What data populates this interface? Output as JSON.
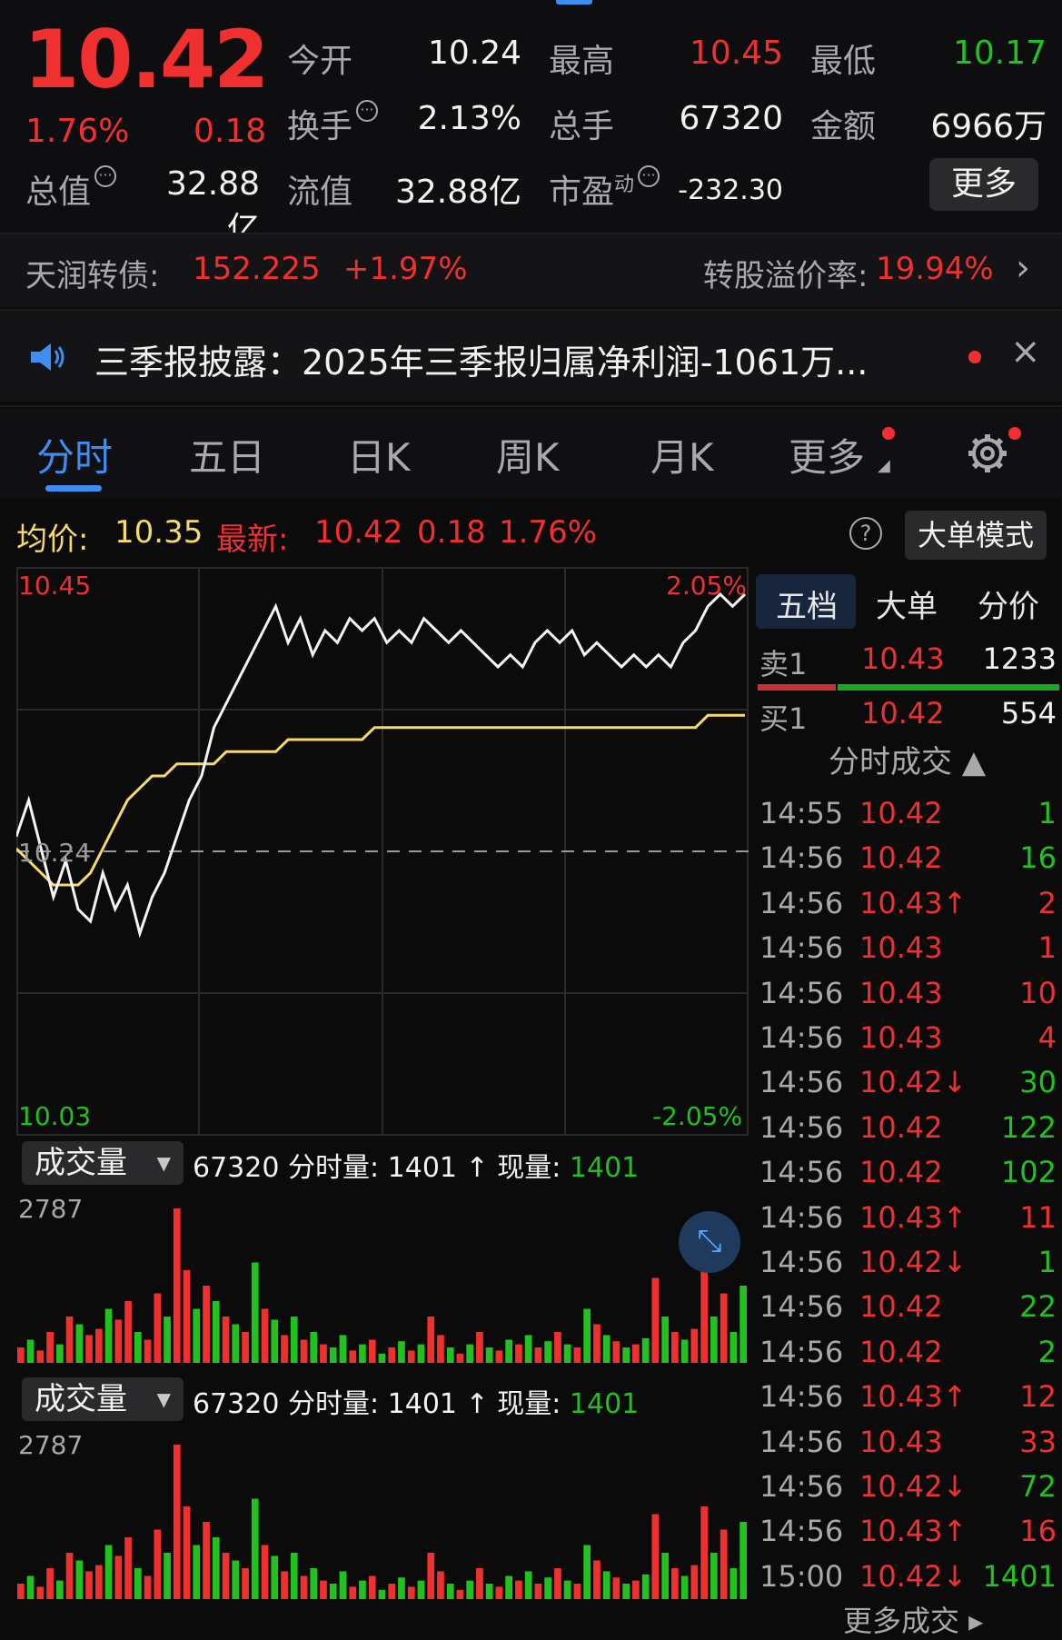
{
  "quote": {
    "price": "10.42",
    "change_pct": "1.76%",
    "change_abs": "0.18",
    "open_label": "今开",
    "open_value": "10.24",
    "high_label": "最高",
    "high_value": "10.45",
    "low_label": "最低",
    "low_value": "10.17",
    "turnover_label": "换手",
    "turnover_value": "2.13%",
    "volume_label": "总手",
    "volume_value": "67320",
    "amount_label": "金额",
    "amount_value": "6966万",
    "mktcap_label": "总值",
    "mktcap_value": "32.88亿",
    "float_label": "流值",
    "float_value": "32.88亿",
    "pe_label": "市盈",
    "pe_sup": "动",
    "pe_value": "-232.30",
    "more_label": "更多",
    "info_icon": "ellipsis-circle-icon"
  },
  "bond": {
    "name": "天润转债:",
    "price": "152.225",
    "change": "+1.97%",
    "premium_label": "转股溢价率:",
    "premium_value": "19.94%"
  },
  "news": {
    "text": "三季报披露：2025年三季报归属净利润-1061万...",
    "icon": "speaker-icon"
  },
  "tabs": {
    "items": [
      "分时",
      "五日",
      "日K",
      "周K",
      "月K",
      "更多"
    ],
    "active": "分时"
  },
  "avg_bar": {
    "avg_label": "均价:",
    "avg_value": "10.35",
    "latest_label": "最新:",
    "latest_price": "10.42",
    "latest_change": "0.18",
    "latest_pct": "1.76%",
    "big_order_mode": "大单模式"
  },
  "chart_data": {
    "type": "line",
    "price_high": "10.45",
    "price_low": "10.03",
    "pct_high": "2.05%",
    "pct_low": "-2.05%",
    "prev_close": "10.24",
    "ylim": [
      10.03,
      10.45
    ],
    "series": [
      {
        "values": [
          10.25,
          10.28,
          10.24,
          10.2,
          10.23,
          10.19,
          10.18,
          10.22,
          10.19,
          10.21,
          10.17,
          10.2,
          10.22,
          10.25,
          10.28,
          10.3,
          10.34,
          10.36,
          10.38,
          10.4,
          10.42,
          10.44,
          10.41,
          10.43,
          10.4,
          10.42,
          10.41,
          10.43,
          10.42,
          10.43,
          10.41,
          10.42,
          10.41,
          10.43,
          10.42,
          10.41,
          10.42,
          10.41,
          10.4,
          10.39,
          10.4,
          10.39,
          10.41,
          10.42,
          10.41,
          10.42,
          10.4,
          10.41,
          10.4,
          10.39,
          10.4,
          10.39,
          10.4,
          10.39,
          10.41,
          10.42,
          10.44,
          10.45,
          10.44,
          10.45
        ]
      },
      {
        "values": [
          10.24,
          10.23,
          10.22,
          10.21,
          10.21,
          10.21,
          10.22,
          10.24,
          10.26,
          10.28,
          10.29,
          10.3,
          10.3,
          10.31,
          10.31,
          10.31,
          10.31,
          10.32,
          10.32,
          10.32,
          10.32,
          10.32,
          10.33,
          10.33,
          10.33,
          10.33,
          10.33,
          10.33,
          10.33,
          10.34,
          10.34,
          10.34,
          10.34,
          10.34,
          10.34,
          10.34,
          10.34,
          10.34,
          10.34,
          10.34,
          10.34,
          10.34,
          10.34,
          10.34,
          10.34,
          10.34,
          10.34,
          10.34,
          10.34,
          10.34,
          10.34,
          10.34,
          10.34,
          10.34,
          10.34,
          10.34,
          10.35,
          10.35,
          10.35,
          10.35
        ]
      }
    ]
  },
  "volume": {
    "selector": "成交量",
    "total": "67320",
    "minute_label": "分时量:",
    "minute_value": "1401",
    "arrow": "↑",
    "current_label": "现量:",
    "current_value": "1401",
    "max": "2787",
    "bars": [
      0.1,
      0.15,
      0.08,
      0.2,
      0.12,
      0.3,
      0.25,
      0.18,
      0.22,
      0.35,
      0.28,
      0.4,
      0.2,
      0.15,
      0.45,
      0.3,
      1.0,
      0.6,
      0.35,
      0.5,
      0.4,
      0.3,
      0.25,
      0.2,
      0.65,
      0.35,
      0.28,
      0.18,
      0.3,
      0.15,
      0.2,
      0.12,
      0.1,
      0.18,
      0.08,
      0.12,
      0.15,
      0.06,
      0.1,
      0.14,
      0.08,
      0.12,
      0.3,
      0.18,
      0.1,
      0.06,
      0.12,
      0.2,
      0.1,
      0.08,
      0.15,
      0.12,
      0.18,
      0.1,
      0.14,
      0.2,
      0.12,
      0.1,
      0.35,
      0.25,
      0.18,
      0.14,
      0.1,
      0.12,
      0.16,
      0.55,
      0.3,
      0.2,
      0.15,
      0.22,
      0.6,
      0.3,
      0.45,
      0.2,
      0.5
    ],
    "bar_colors": [
      "red",
      "green",
      "red",
      "red",
      "green",
      "red",
      "green",
      "red",
      "red",
      "green",
      "red",
      "red",
      "green",
      "red",
      "red",
      "green",
      "red",
      "red",
      "green",
      "red",
      "green",
      "red",
      "green",
      "red",
      "green",
      "red",
      "green",
      "red",
      "green",
      "red",
      "green",
      "red",
      "green",
      "green",
      "red",
      "green",
      "red",
      "green",
      "red",
      "green",
      "red",
      "green",
      "red",
      "red",
      "green",
      "red",
      "green",
      "red",
      "green",
      "red",
      "green",
      "red",
      "green",
      "red",
      "green",
      "red",
      "green",
      "red",
      "green",
      "red",
      "green",
      "red",
      "green",
      "red",
      "green",
      "red",
      "green",
      "red",
      "green",
      "red",
      "red",
      "green",
      "red",
      "green",
      "green"
    ]
  },
  "right_panel": {
    "tabs": [
      "五档",
      "大单",
      "分价"
    ],
    "sell1_label": "卖1",
    "sell1_price": "10.43",
    "sell1_vol": "1233",
    "buy1_label": "买1",
    "buy1_price": "10.42",
    "buy1_vol": "554",
    "ticks_title": "分时成交 ▲",
    "ticks": [
      {
        "t": "14:55",
        "p": "10.42",
        "v": "1",
        "pc": "red",
        "vc": "green"
      },
      {
        "t": "14:56",
        "p": "10.42",
        "v": "16",
        "pc": "red",
        "vc": "green"
      },
      {
        "t": "14:56",
        "p": "10.43↑",
        "v": "2",
        "pc": "red",
        "vc": "red"
      },
      {
        "t": "14:56",
        "p": "10.43",
        "v": "1",
        "pc": "red",
        "vc": "red"
      },
      {
        "t": "14:56",
        "p": "10.43",
        "v": "10",
        "pc": "red",
        "vc": "red"
      },
      {
        "t": "14:56",
        "p": "10.43",
        "v": "4",
        "pc": "red",
        "vc": "red"
      },
      {
        "t": "14:56",
        "p": "10.42↓",
        "v": "30",
        "pc": "red",
        "vc": "green"
      },
      {
        "t": "14:56",
        "p": "10.42",
        "v": "122",
        "pc": "red",
        "vc": "green"
      },
      {
        "t": "14:56",
        "p": "10.42",
        "v": "102",
        "pc": "red",
        "vc": "green"
      },
      {
        "t": "14:56",
        "p": "10.43↑",
        "v": "11",
        "pc": "red",
        "vc": "red"
      },
      {
        "t": "14:56",
        "p": "10.42↓",
        "v": "1",
        "pc": "red",
        "vc": "green"
      },
      {
        "t": "14:56",
        "p": "10.42",
        "v": "22",
        "pc": "red",
        "vc": "green"
      },
      {
        "t": "14:56",
        "p": "10.42",
        "v": "2",
        "pc": "red",
        "vc": "green"
      },
      {
        "t": "14:56",
        "p": "10.43↑",
        "v": "12",
        "pc": "red",
        "vc": "red"
      },
      {
        "t": "14:56",
        "p": "10.43",
        "v": "33",
        "pc": "red",
        "vc": "red"
      },
      {
        "t": "14:56",
        "p": "10.42↓",
        "v": "72",
        "pc": "red",
        "vc": "green"
      },
      {
        "t": "14:56",
        "p": "10.43↑",
        "v": "16",
        "pc": "red",
        "vc": "red"
      },
      {
        "t": "15:00",
        "p": "10.42↓",
        "v": "1401",
        "pc": "red",
        "vc": "green"
      }
    ],
    "more_ticks": "更多成交 ▸"
  },
  "colors": {
    "up": "#f0302f",
    "down": "#21c21f",
    "accent": "#3d8ef0",
    "avg_line": "#f5d96b"
  }
}
